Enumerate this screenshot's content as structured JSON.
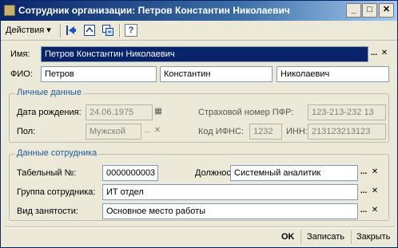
{
  "window": {
    "title": "Сотрудник организации: Петров Константин Николаевич"
  },
  "toolbar": {
    "actions_label": "Действия",
    "help_label": "?"
  },
  "fields": {
    "name_label": "Имя:",
    "name_value": "Петров Константин Николаевич",
    "fio_label": "ФИО:",
    "last_name": "Петров",
    "first_name": "Константин",
    "middle_name": "Николаевич"
  },
  "personal": {
    "title": "Личные данные",
    "birth_label": "Дата рождения:",
    "birth_value": "24.06.1975",
    "sex_label": "Пол:",
    "sex_value": "Мужской",
    "pfr_label": "Страховой номер ПФР:",
    "pfr_value": "123-213-232 13",
    "ifns_label": "Код ИФНС:",
    "ifns_value": "1232",
    "inn_label": "ИНН:",
    "inn_value": "213123213123"
  },
  "employee": {
    "title": "Данные сотрудника",
    "tabnum_label": "Табельный №:",
    "tabnum_value": "0000000003",
    "position_label": "Должность:",
    "position_value": "Системный аналитик",
    "group_label": "Группа сотрудника:",
    "group_value": "ИТ отдел",
    "employment_label": "Вид занятости:",
    "employment_value": "Основное место работы"
  },
  "footer": {
    "ok": "OK",
    "save": "Записать",
    "close": "Закрыть"
  },
  "glyphs": {
    "pick": "...",
    "clear": "✕",
    "calendar": "▦",
    "minimize": "_",
    "maximize": "□",
    "close": "✕",
    "dropdown": "▾"
  },
  "colors": {
    "title_bar": "#0a246a",
    "selected_field": "#0a246a",
    "group_title": "#1e5aa0",
    "window_bg": "#ece9d8"
  }
}
